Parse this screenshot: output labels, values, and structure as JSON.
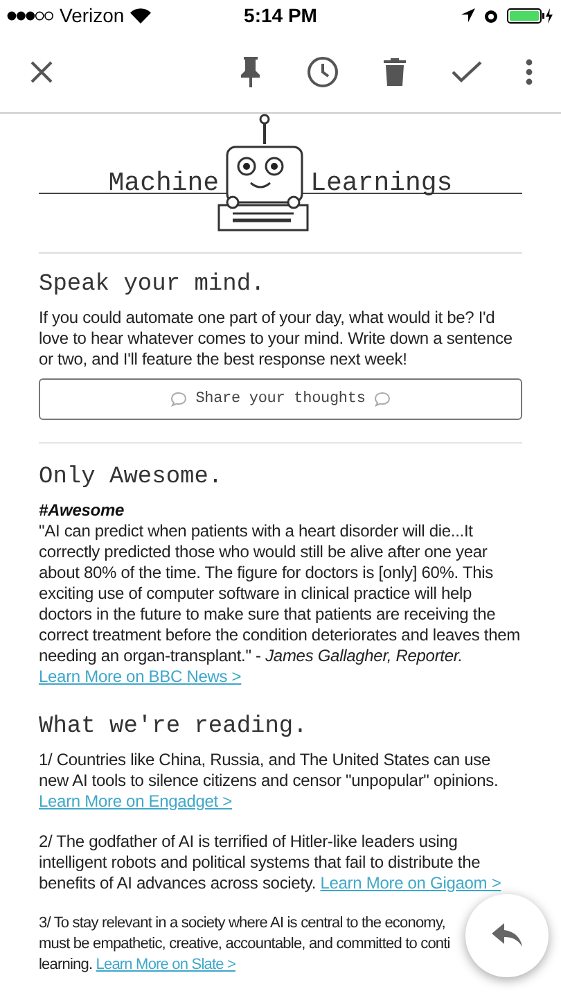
{
  "status_bar": {
    "carrier": "Verizon",
    "time": "5:14 PM"
  },
  "logo": {
    "left": "Machine",
    "right": "Learnings"
  },
  "sections": [
    {
      "kind": "prompt",
      "heading": "Speak your mind.",
      "body": "If you could automate one part of your day, what would it be? I'd love to hear whatever comes to your mind. Write down a sentence or two, and I'll feature the best response next week!",
      "button": "Share your thoughts"
    },
    {
      "kind": "quote",
      "heading": "Only Awesome.",
      "tag": "#Awesome",
      "body": "\"AI can predict when patients with a heart disorder will die...It correctly predicted those who would still be alive after one year about 80% of the time. The figure for doctors is [only] 60%. This exciting use of computer software in clinical practice will help doctors in the future to make sure that patients are receiving the correct treatment before the condition deteriorates and leaves them needing an organ-transplant.\" - *James Gallagher, Reporter.*",
      "link": "Learn More on BBC News >"
    },
    {
      "kind": "list",
      "heading": "What we're reading.",
      "items": [
        {
          "kind": "paragraph",
          "text": "1/ Countries like China, Russia, and The United States can use new AI tools to silence citizens and censor \"unpopular\" opinions.",
          "link": "Learn More on Engadget >"
        },
        {
          "kind": "paragraph",
          "text": "2/ The godfather of AI is terrified of Hitler-like leaders using intelligent robots and political systems that fail to distribute the benefits of AI advances across society.",
          "link": "Learn More on Gigaom >"
        },
        {
          "kind": "lines",
          "lines": [
            "3/ To stay relevant in a society where AI is central to the economy,",
            "must be empathetic, creative, accountable, and committed to conti",
            "learning."
          ],
          "link": "Learn More on Slate >"
        }
      ]
    }
  ]
}
